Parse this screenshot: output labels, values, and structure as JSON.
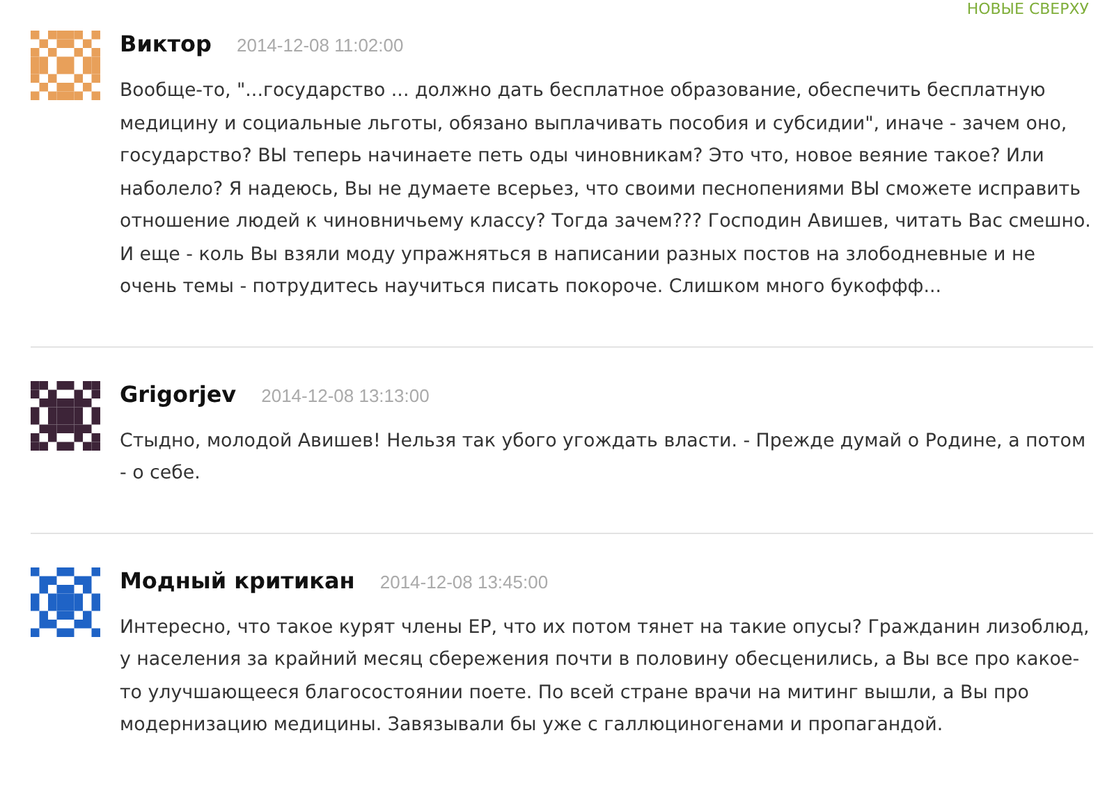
{
  "sort_link": "НОВЫЕ СВЕРХУ",
  "comments": [
    {
      "author": "Виктор",
      "date": "2014-12-08 11:02:00",
      "color": "#e8a05a",
      "text": "Вообще-то, \"...государство ... должно дать бесплатное образование, обеспечить бесплатную медицину и социальные льготы, обязано выплачивать пособия и субсидии\", иначе - зачем оно, государство? ВЫ теперь начинаете петь оды чиновникам? Это что, новое веяние такое? Или наболело? Я надеюсь, Вы не думаете всерьез, что своими песнопениями ВЫ сможете исправить отношение людей к чиновничьему классу? Тогда зачем??? Господин Авишев, читать Вас смешно. И еще - коль Вы взяли моду упражняться в написании разных постов на злободневные и не очень темы - потрудитесь научиться писать покороче. Слишком много букоффф..."
    },
    {
      "author": "Grigorjev",
      "date": "2014-12-08 13:13:00",
      "color": "#3d2438",
      "text": "Стыдно, молодой Авишев! Нельзя так убого угождать власти. - Прежде думай о Родине, а потом - о себе."
    },
    {
      "author": "Модный критикан",
      "date": "2014-12-08 13:45:00",
      "color": "#1f63c6",
      "text": "Интересно, что такое курят члены ЕР, что их потом тянет на такие опусы? Гражданин лизоблюд, у населения за крайний месяц сбережения почти в половину обесценились, а Вы все про какое-то улучшающееся благосостоянии поете. По всей стране врачи на митинг вышли, а Вы про модернизацию медицины. Завязывали бы уже с галлюциногенами и пропагандой."
    }
  ]
}
